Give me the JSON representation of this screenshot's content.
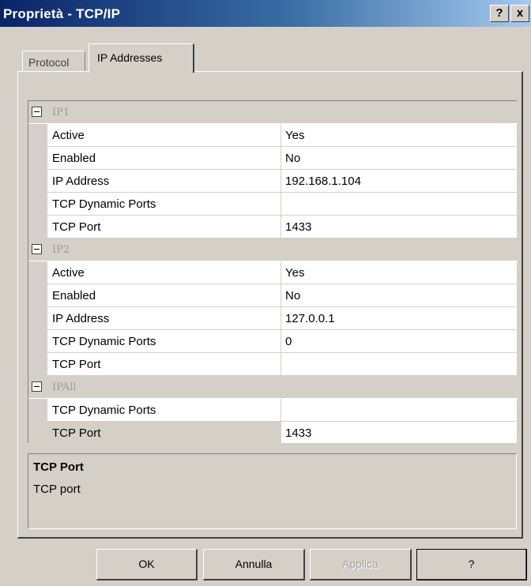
{
  "window": {
    "title": "Proprietà - TCP/IP",
    "help_label": "?",
    "close_label": "x"
  },
  "tabs": [
    {
      "label": "Protocol",
      "active": false
    },
    {
      "label": "IP Addresses",
      "active": true
    }
  ],
  "grid": {
    "rows": [
      {
        "type": "category",
        "name": "IP1"
      },
      {
        "type": "prop",
        "name": "Active",
        "value": "Yes"
      },
      {
        "type": "prop",
        "name": "Enabled",
        "value": "No"
      },
      {
        "type": "prop",
        "name": "IP Address",
        "value": "192.168.1.104"
      },
      {
        "type": "prop",
        "name": "TCP Dynamic Ports",
        "value": ""
      },
      {
        "type": "prop",
        "name": "TCP Port",
        "value": "1433"
      },
      {
        "type": "category",
        "name": "IP2"
      },
      {
        "type": "prop",
        "name": "Active",
        "value": "Yes"
      },
      {
        "type": "prop",
        "name": "Enabled",
        "value": "No"
      },
      {
        "type": "prop",
        "name": "IP Address",
        "value": "127.0.0.1"
      },
      {
        "type": "prop",
        "name": "TCP Dynamic Ports",
        "value": "0"
      },
      {
        "type": "prop",
        "name": "TCP Port",
        "value": ""
      },
      {
        "type": "category",
        "name": "IPAll"
      },
      {
        "type": "prop",
        "name": "TCP Dynamic Ports",
        "value": ""
      },
      {
        "type": "prop",
        "name": "TCP Port",
        "value": "1433",
        "selected": true
      }
    ]
  },
  "description": {
    "title": "TCP Port",
    "text": "TCP port"
  },
  "buttons": {
    "ok": "OK",
    "cancel": "Annulla",
    "apply": "Applica",
    "help": "?"
  },
  "colors": {
    "titlebar_start": "#0a246a",
    "titlebar_end": "#a6caf0",
    "face": "#d4d0c8",
    "category_text": "#9a9a9a",
    "disabled_text": "#a0a0a0"
  }
}
